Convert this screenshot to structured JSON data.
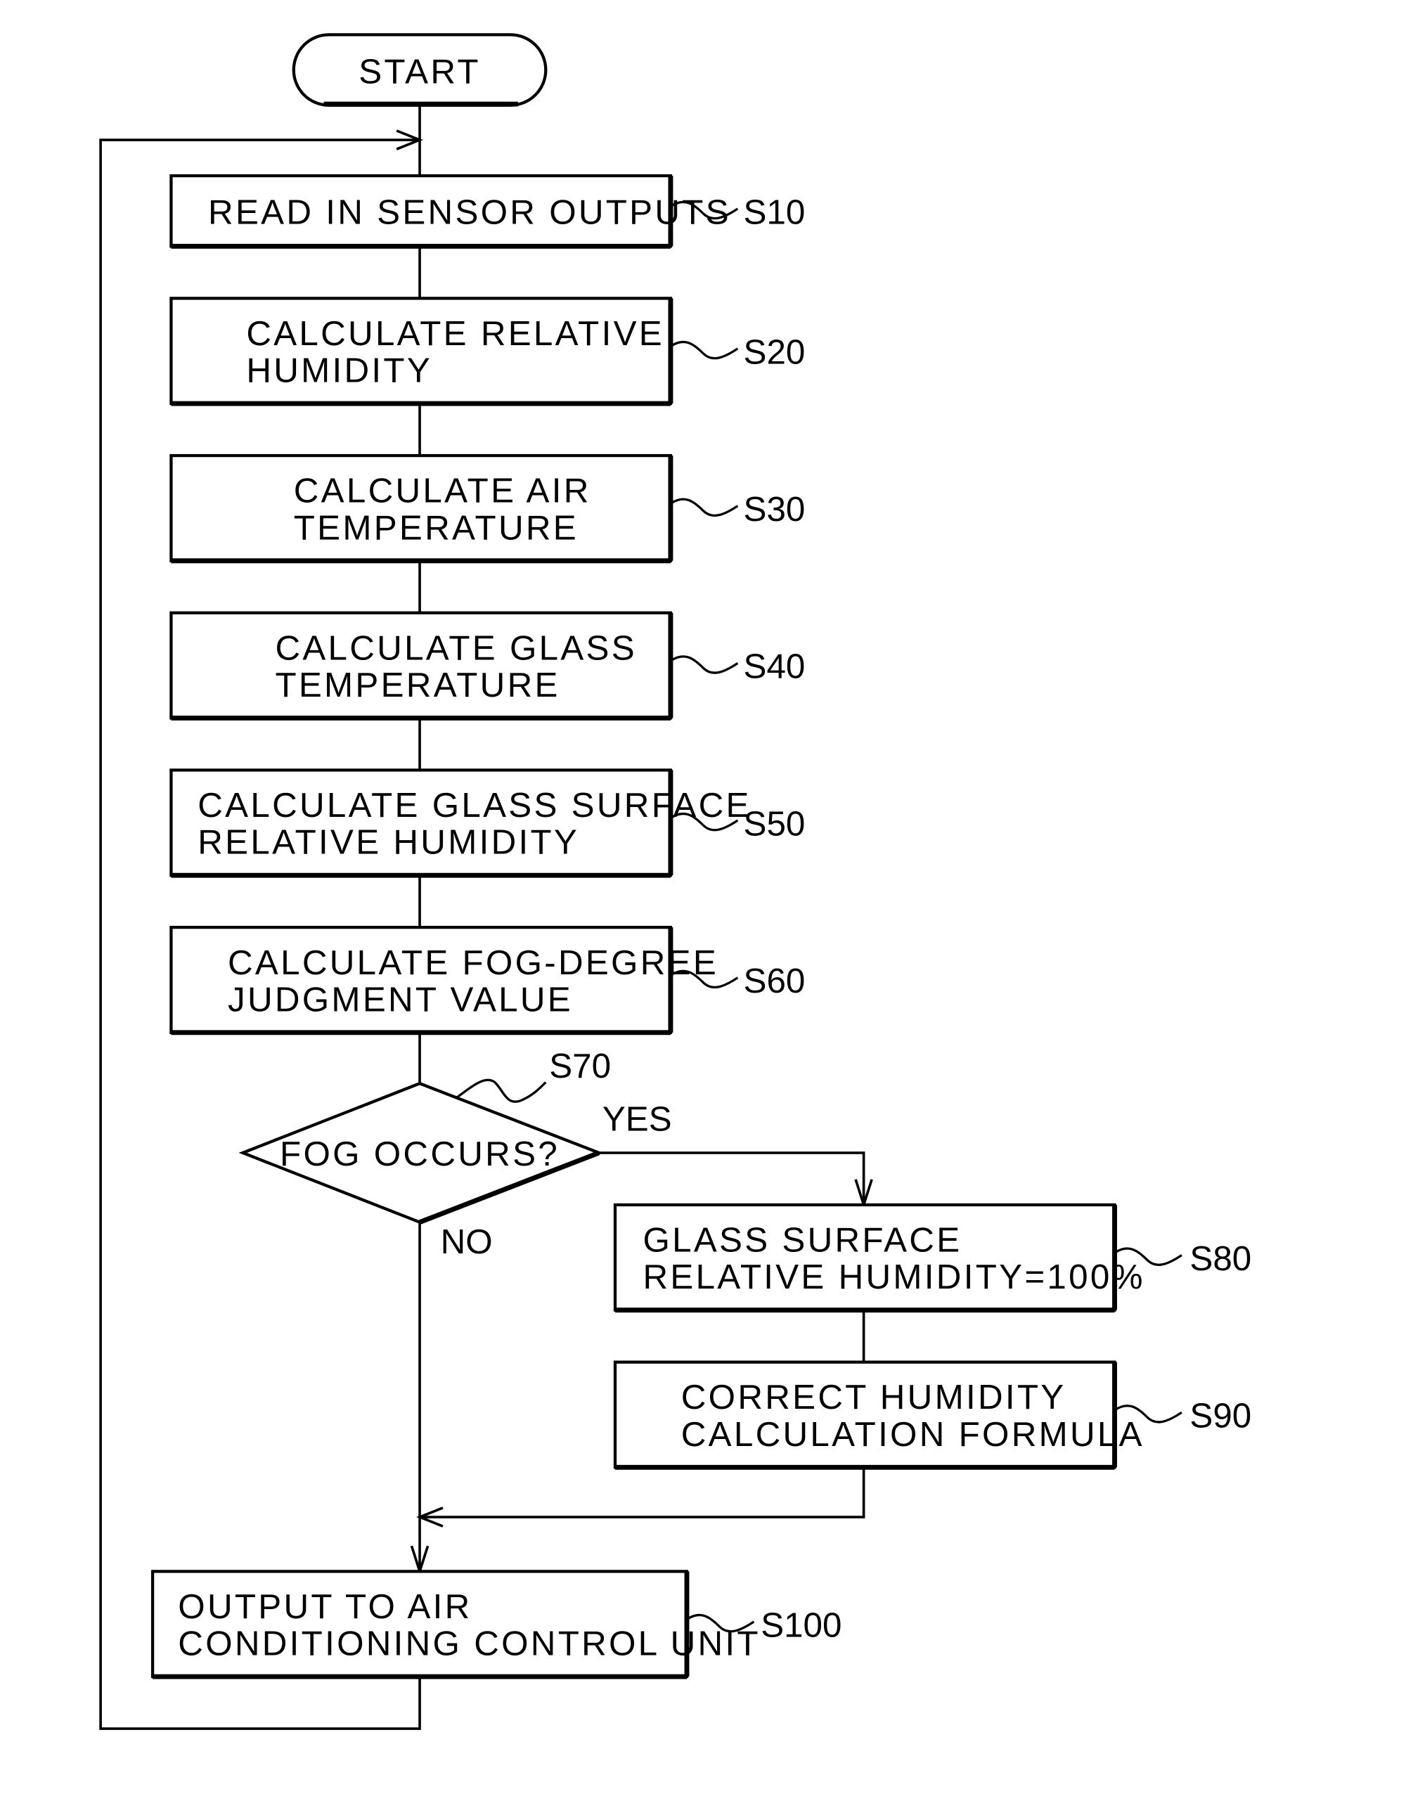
{
  "diagram": {
    "type": "flowchart",
    "start": {
      "label": "START"
    },
    "steps": [
      {
        "id": "S10",
        "lines": [
          "READ IN SENSOR OUTPUTS"
        ]
      },
      {
        "id": "S20",
        "lines": [
          "CALCULATE RELATIVE",
          "HUMIDITY"
        ]
      },
      {
        "id": "S30",
        "lines": [
          "CALCULATE AIR",
          "TEMPERATURE"
        ]
      },
      {
        "id": "S40",
        "lines": [
          "CALCULATE GLASS",
          "TEMPERATURE"
        ]
      },
      {
        "id": "S50",
        "lines": [
          "CALCULATE GLASS SURFACE",
          "RELATIVE HUMIDITY"
        ]
      },
      {
        "id": "S60",
        "lines": [
          "CALCULATE FOG-DEGREE",
          "JUDGMENT VALUE"
        ]
      },
      {
        "id": "S80",
        "lines": [
          "GLASS SURFACE",
          "RELATIVE HUMIDITY=100%"
        ]
      },
      {
        "id": "S90",
        "lines": [
          "CORRECT HUMIDITY",
          "CALCULATION FORMULA"
        ]
      },
      {
        "id": "S100",
        "lines": [
          "OUTPUT TO AIR",
          "CONDITIONING CONTROL UNIT"
        ]
      }
    ],
    "decision": {
      "id": "S70",
      "label": "FOG OCCURS?",
      "yes_label": "YES",
      "no_label": "NO"
    },
    "edges": [
      {
        "from": "START",
        "to": "S10"
      },
      {
        "from": "S10",
        "to": "S20"
      },
      {
        "from": "S20",
        "to": "S30"
      },
      {
        "from": "S30",
        "to": "S40"
      },
      {
        "from": "S40",
        "to": "S50"
      },
      {
        "from": "S50",
        "to": "S60"
      },
      {
        "from": "S60",
        "to": "S70"
      },
      {
        "from": "S70",
        "to": "S80",
        "label": "YES"
      },
      {
        "from": "S80",
        "to": "S90"
      },
      {
        "from": "S90",
        "to": "S100"
      },
      {
        "from": "S70",
        "to": "S100",
        "label": "NO"
      },
      {
        "from": "S100",
        "to": "S10",
        "note": "loop back"
      }
    ]
  }
}
